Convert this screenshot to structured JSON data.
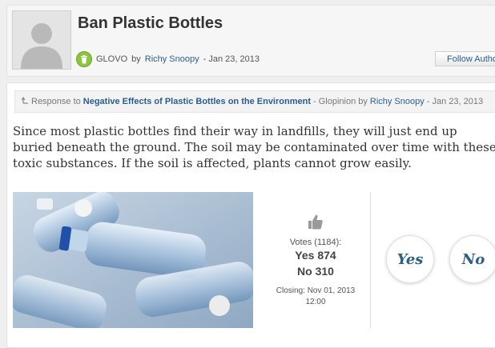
{
  "header": {
    "title": "Ban Plastic Bottles",
    "category": "GLOVO",
    "by_word": "by",
    "author": "Richy Snoopy",
    "date": "- Jan 23, 2013",
    "follow_label": "Follow Author"
  },
  "response": {
    "prefix": "Response to",
    "link_text": "Negative Effects of Plastic Bottles on the Environment",
    "middle": "- Glopinion by",
    "author": "Richy Snoopy",
    "date": "- Jan 23, 2013"
  },
  "argument_text": "Since most plastic bottles find their way in landfills, they will just end up buried beneath the ground. The soil may be contaminated over time with these toxic substances. If the soil is affected, plants cannot grow easily.",
  "voting": {
    "votes_label": "Votes (1184):",
    "yes_count": "Yes 874",
    "no_count": "No 310",
    "closing_label": "Closing: Nov 01, 2013",
    "closing_time": "12:00",
    "yes_button": "Yes",
    "no_button": "No"
  },
  "colors": {
    "link": "#2a5d8f",
    "badge": "#8cc63f",
    "vote_text": "#2d5f86"
  },
  "icons": {
    "category": "trash-icon",
    "vote": "thumbs-up-icon",
    "response": "reply-arrow-icon"
  }
}
